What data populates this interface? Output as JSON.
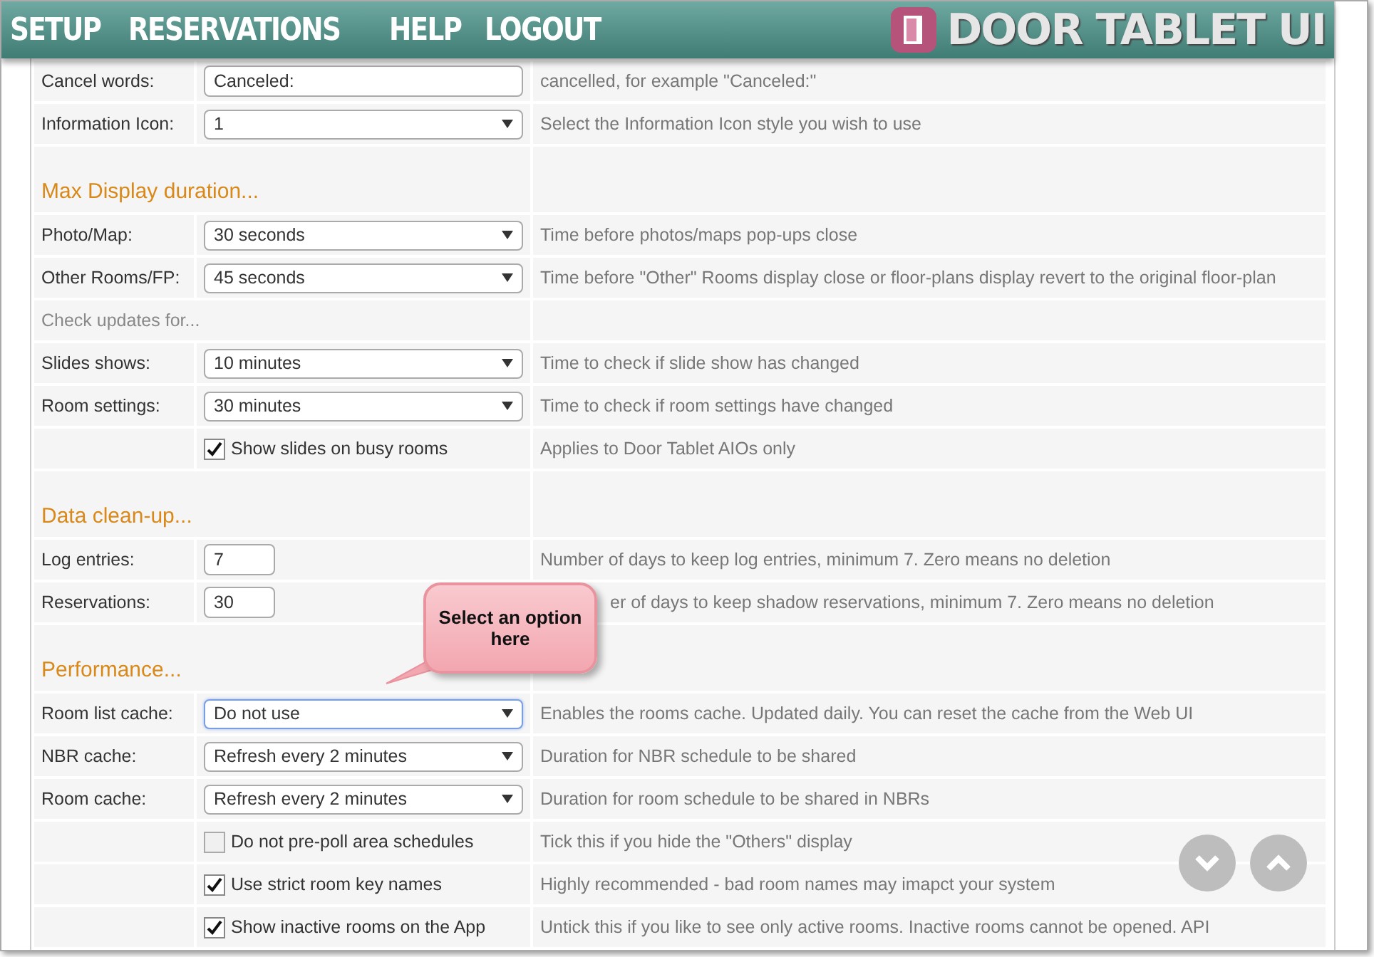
{
  "nav": {
    "links": [
      "SETUP",
      "RESERVATIONS",
      "HELP",
      "LOGOUT"
    ],
    "brand": "DOOR TABLET UI"
  },
  "rows": [
    {
      "kind": "text",
      "label": "Cancel words:",
      "value": "Canceled:",
      "description": "cancelled, for example \"Canceled:\""
    },
    {
      "kind": "select",
      "label": "Information Icon:",
      "value": "1",
      "focused": false,
      "description": "Select the Information Icon style you wish to use"
    },
    {
      "kind": "heading",
      "label": "Max Display duration..."
    },
    {
      "kind": "select",
      "label": "Photo/Map:",
      "value": "30 seconds",
      "focused": false,
      "description": "Time before photos/maps pop-ups close"
    },
    {
      "kind": "select",
      "label": "Other Rooms/FP:",
      "value": "45 seconds",
      "focused": false,
      "description": "Time before \"Other\" Rooms display close or floor-plans display revert to the original floor-plan"
    },
    {
      "kind": "subheading",
      "label": "Check updates for..."
    },
    {
      "kind": "select",
      "label": "Slides shows:",
      "value": "10 minutes",
      "focused": false,
      "description": "Time to check if slide show has changed"
    },
    {
      "kind": "select",
      "label": "Room settings:",
      "value": "30 minutes",
      "focused": false,
      "description": "Time to check if room settings have changed"
    },
    {
      "kind": "checkbox",
      "label": "Show slides on busy rooms",
      "checked": true,
      "description": "Applies to Door Tablet AIOs only"
    },
    {
      "kind": "heading",
      "label": "Data clean-up..."
    },
    {
      "kind": "number",
      "label": "Log entries:",
      "value": "7",
      "description": "Number of days to keep log entries, minimum 7.  Zero means no deletion"
    },
    {
      "kind": "number",
      "label": "Reservations:",
      "value": "30",
      "description": "er of days to keep shadow reservations, minimum 7.  Zero means no deletion",
      "covered": true
    },
    {
      "kind": "heading",
      "label": "Performance..."
    },
    {
      "kind": "select",
      "label": "Room list cache:",
      "value": "Do not use",
      "focused": true,
      "description": "Enables the rooms cache. Updated daily. You can reset the cache from the Web UI"
    },
    {
      "kind": "select",
      "label": "NBR cache:",
      "value": "Refresh every 2 minutes",
      "focused": false,
      "description": "Duration for NBR schedule to be shared"
    },
    {
      "kind": "select",
      "label": "Room cache:",
      "value": "Refresh every 2 minutes",
      "focused": false,
      "description": "Duration for room schedule to be shared in NBRs"
    },
    {
      "kind": "checkbox",
      "label": "Do not pre-poll area schedules",
      "checked": false,
      "description": "Tick this if you hide the \"Others\" display"
    },
    {
      "kind": "checkbox",
      "label": "Use strict room key names",
      "checked": true,
      "description": "Highly recommended - bad room names may imapct your system"
    },
    {
      "kind": "checkbox",
      "label": "Show inactive rooms on the App",
      "checked": true,
      "description": "Untick this if you like to see only active rooms. Inactive rooms cannot be opened.  API"
    }
  ],
  "callout": {
    "text": "Select an option here"
  }
}
